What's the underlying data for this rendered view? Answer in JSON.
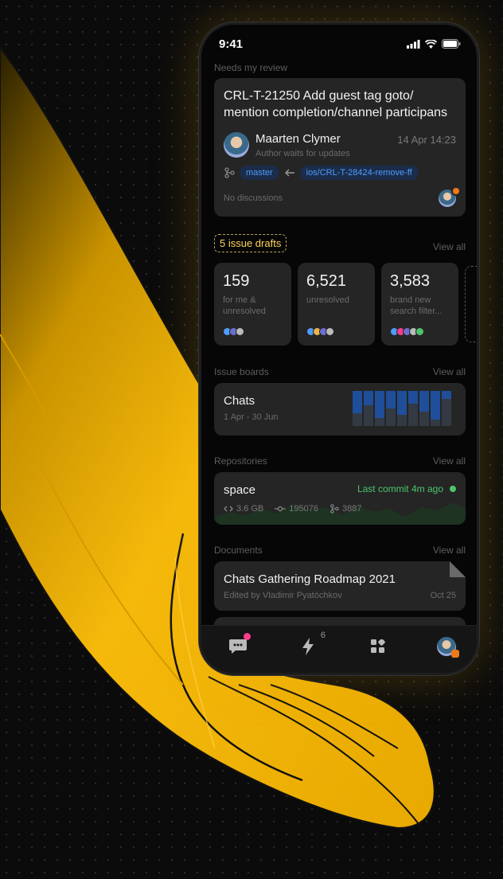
{
  "status": {
    "time": "9:41"
  },
  "review": {
    "section": "Needs my review",
    "title": "CRL-T-21250 Add guest tag goto/ mention completion/channel participans",
    "author": "Maarten Clymer",
    "author_status": "Author waits for updates",
    "date": "14 Apr 14:23",
    "target_branch": "master",
    "source_branch": "ios/CRL-T-28424-remove-ff",
    "discussions": "No discussions"
  },
  "drafts": {
    "label": "5 issue drafts",
    "view_all": "View all",
    "stats": [
      {
        "value": "159",
        "label": "for me & unresolved"
      },
      {
        "value": "6,521",
        "label": "unresolved"
      },
      {
        "value": "3,583",
        "label": "brand new search filter..."
      }
    ]
  },
  "boards": {
    "section": "Issue boards",
    "view_all": "View all",
    "name": "Chats",
    "range": "1 Apr - 30 Jun"
  },
  "repos": {
    "section": "Repositories",
    "view_all": "View all",
    "name": "space",
    "last_commit": "Last commit 4m ago",
    "size": "3.6 GB",
    "commits": "195076",
    "branches": "3887"
  },
  "docs": {
    "section": "Documents",
    "view_all": "View all",
    "title": "Chats Gathering Roadmap 2021",
    "editor": "Edited by Vladimir Pyatóchkov",
    "date": "Oct 25"
  },
  "tabbar": {
    "activity_badge": "6"
  },
  "colors": {
    "accent_blue": "#4f9cff",
    "accent_green": "#4cc46a",
    "hand_yellow": "#f5b90b",
    "badge_pink": "#ff3d8a"
  }
}
